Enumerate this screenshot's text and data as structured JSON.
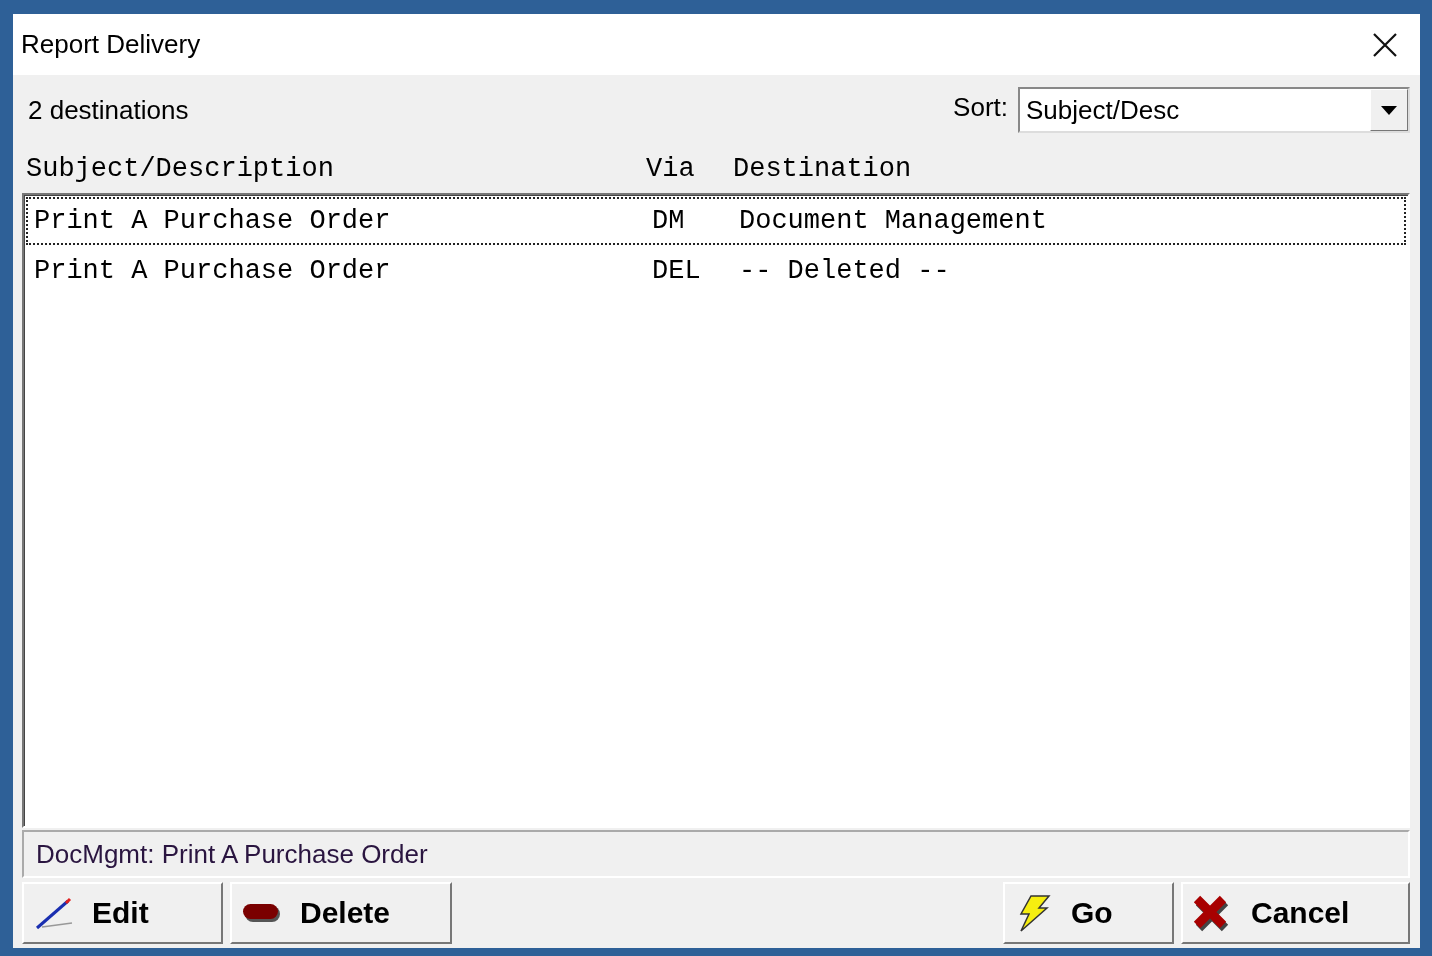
{
  "window": {
    "title": "Report Delivery"
  },
  "count_label": "2 destinations",
  "sort": {
    "label": "Sort:",
    "value": "Subject/Desc"
  },
  "table": {
    "columns": [
      "Subject/Description",
      "Via",
      "Destination"
    ],
    "rows": [
      {
        "cells": [
          "Print A Purchase Order",
          "DM",
          "Document Management"
        ],
        "selected": true
      },
      {
        "cells": [
          "Print A Purchase Order",
          "DEL",
          "-- Deleted --"
        ],
        "selected": false
      }
    ]
  },
  "status_bar": "DocMgmt: Print A Purchase Order",
  "buttons": [
    {
      "label": "Edit",
      "kind": "edit"
    },
    {
      "label": "Delete",
      "kind": "delete"
    },
    {
      "label": "Go",
      "kind": "go"
    },
    {
      "label": "Cancel",
      "kind": "cancel"
    }
  ]
}
